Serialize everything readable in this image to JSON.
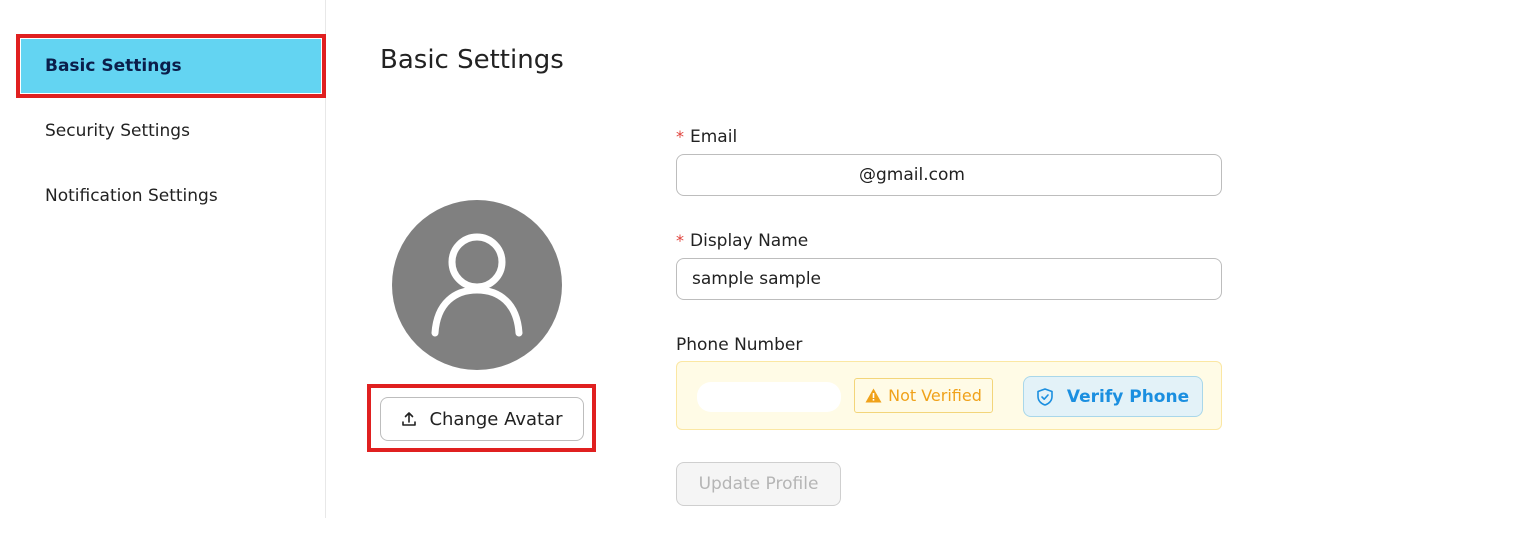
{
  "sidebar": {
    "items": [
      {
        "label": "Basic Settings",
        "active": true
      },
      {
        "label": "Security Settings",
        "active": false
      },
      {
        "label": "Notification Settings",
        "active": false
      }
    ]
  },
  "main": {
    "title": "Basic Settings",
    "avatar": {
      "icon": "user-icon",
      "change_label": "Change Avatar",
      "change_icon": "upload-icon"
    },
    "form": {
      "email": {
        "label": "Email",
        "required": true,
        "value": "@gmail.com"
      },
      "display_name": {
        "label": "Display Name",
        "required": true,
        "value": "sample sample"
      },
      "phone": {
        "label": "Phone Number",
        "status": "Not Verified",
        "status_icon": "warning-icon",
        "verify_label": "Verify Phone",
        "verify_icon": "shield-check-icon"
      },
      "submit_label": "Update Profile"
    }
  },
  "colors": {
    "active_bg": "#63d4f2",
    "highlight_border": "#e02020",
    "warning": "#f0a21a",
    "verify_text": "#1b8fe0",
    "avatar_bg": "#808080"
  }
}
